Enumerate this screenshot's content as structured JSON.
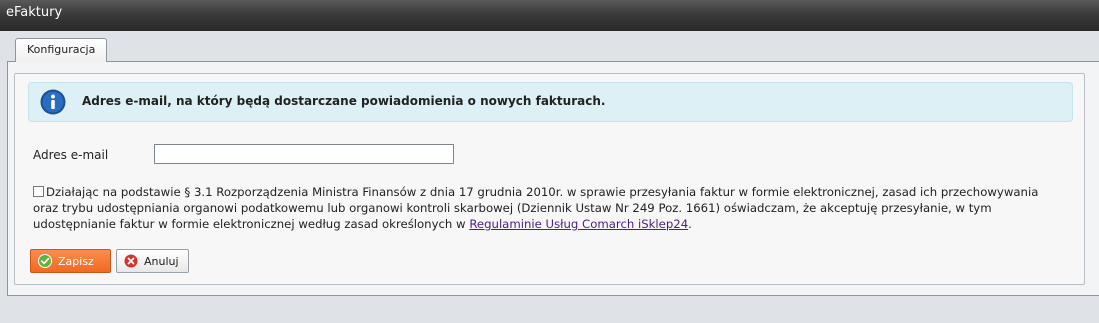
{
  "window": {
    "title": "eFaktury"
  },
  "tabs": [
    {
      "label": "Konfiguracja"
    }
  ],
  "info": {
    "icon": "info-icon",
    "message": "Adres e-mail, na który będą dostarczane powiadomienia o nowych fakturach."
  },
  "email": {
    "label": "Adres e-mail",
    "value": ""
  },
  "consent": {
    "checked": false,
    "text": "Działając na podstawie § 3.1 Rozporządzenia Ministra Finansów z dnia 17 grudnia 2010r. w sprawie przesyłania faktur w formie elektronicznej, zasad ich przechowywania oraz trybu udostępniania organowi podatkowemu lub organowi kontroli skarbowej (Dziennik Ustaw Nr 249 Poz. 1661) oświadczam, że akceptuję przesyłanie, w tym udostępnianie faktur w formie elektronicznej według zasad określonych w ",
    "link_text": "Regulaminie Usług Comarch iSklep24",
    "suffix": "."
  },
  "buttons": {
    "save_label": "Zapisz",
    "cancel_label": "Anuluj"
  },
  "colors": {
    "accent": "#f06a22",
    "info_bg": "#dcf0f5",
    "link": "#4b1e82"
  }
}
